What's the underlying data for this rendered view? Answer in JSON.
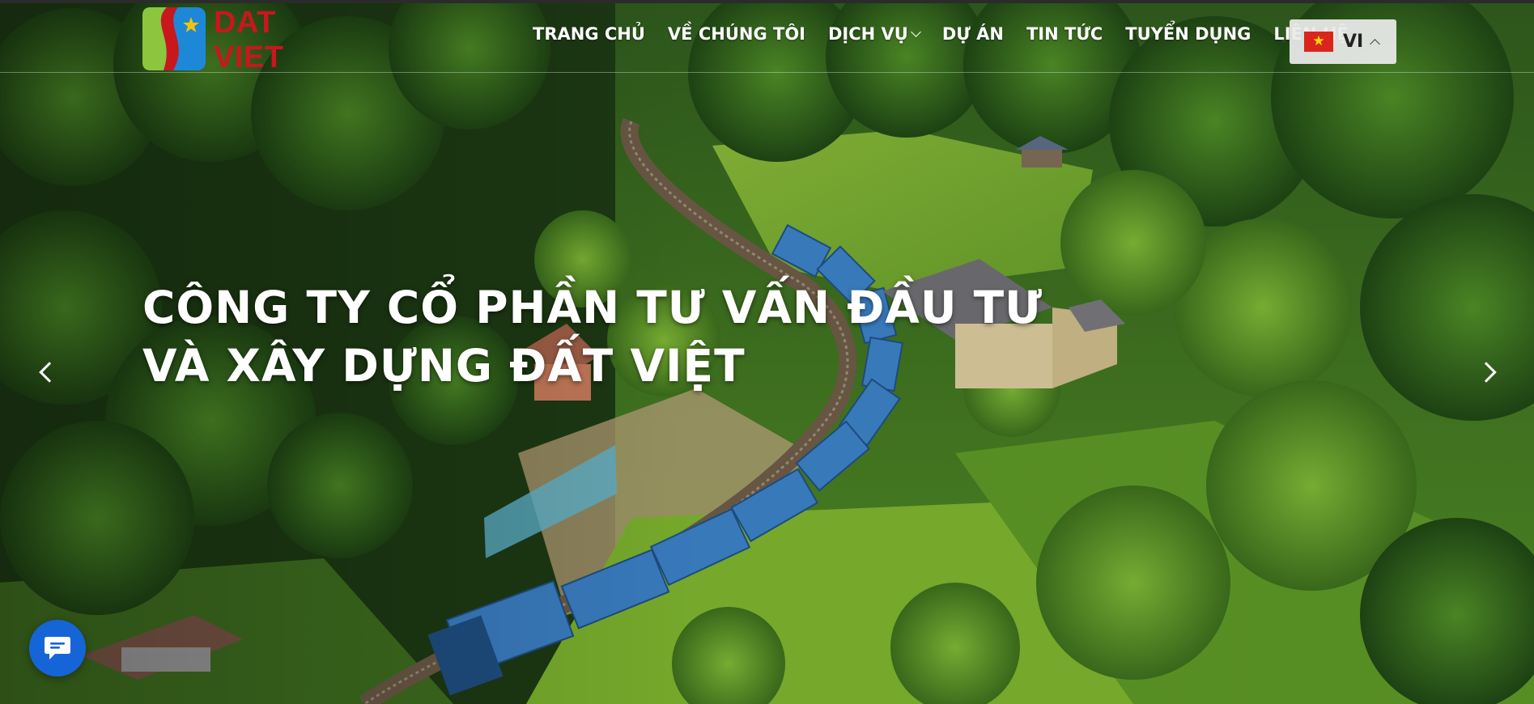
{
  "brand": {
    "logo_text": "DAT VIET",
    "logo_colors": {
      "green": "#8cc63f",
      "blue": "#1e88d8",
      "red": "#c8171d",
      "star": "#f5c400"
    }
  },
  "nav": {
    "items": [
      {
        "label": "TRANG CHỦ"
      },
      {
        "label": "VỀ CHÚNG TÔI"
      },
      {
        "label": "DỊCH VỤ",
        "has_dropdown": true
      },
      {
        "label": "DỰ ÁN"
      },
      {
        "label": "TIN TỨC"
      },
      {
        "label": "TUYỂN DỤNG"
      },
      {
        "label": "LIÊN HỆ"
      }
    ]
  },
  "language": {
    "code": "VI",
    "flag": "vietnam-flag-icon",
    "flag_colors": {
      "field": "#da251d",
      "star": "#ffde00"
    }
  },
  "hero": {
    "headline_line1": "CÔNG TY CỔ PHẦN TƯ VẤN ĐẦU TƯ",
    "headline_line2": "VÀ XÂY DỰNG ĐẤT VIỆT",
    "image": "hillside-railway-train-photo",
    "prev_icon": "chevron-left-icon",
    "next_icon": "chevron-right-icon"
  },
  "chat": {
    "icon": "chat-bubble-icon",
    "color": "#1565d8"
  }
}
